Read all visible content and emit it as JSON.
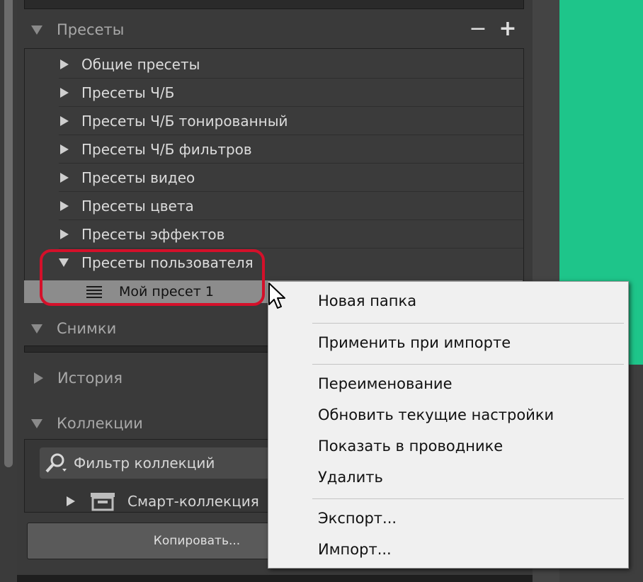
{
  "presets_panel": {
    "header": "Пресеты",
    "minus": "−",
    "plus": "+",
    "items": [
      {
        "label": "Общие пресеты"
      },
      {
        "label": "Пресеты Ч/Б"
      },
      {
        "label": "Пресеты Ч/Б тонированный"
      },
      {
        "label": "Пресеты Ч/Б фильтров"
      },
      {
        "label": "Пресеты видео"
      },
      {
        "label": "Пресеты цвета"
      },
      {
        "label": "Пресеты эффектов"
      },
      {
        "label": "Пресеты пользователя"
      }
    ],
    "selected_preset": "Мой пресет 1"
  },
  "snapshots": {
    "header": "Снимки"
  },
  "history": {
    "header": "История"
  },
  "collections": {
    "header": "Коллекции",
    "filter_placeholder": "Фильтр коллекций",
    "smart_collection": "Смарт-коллекция"
  },
  "copy_button": "Копировать...",
  "context_menu": {
    "new_folder": "Новая папка",
    "apply_on_import": "Применить при импорте",
    "rename": "Переименование",
    "update_settings": "Обновить текущие настройки",
    "show_in_explorer": "Показать в проводнике",
    "delete": "Удалить",
    "export": "Экспорт...",
    "import": "Импорт..."
  },
  "colors": {
    "highlight_ring": "#d4102a",
    "preview_green": "#1ec58a",
    "panel_bg": "#3a3a3a"
  }
}
